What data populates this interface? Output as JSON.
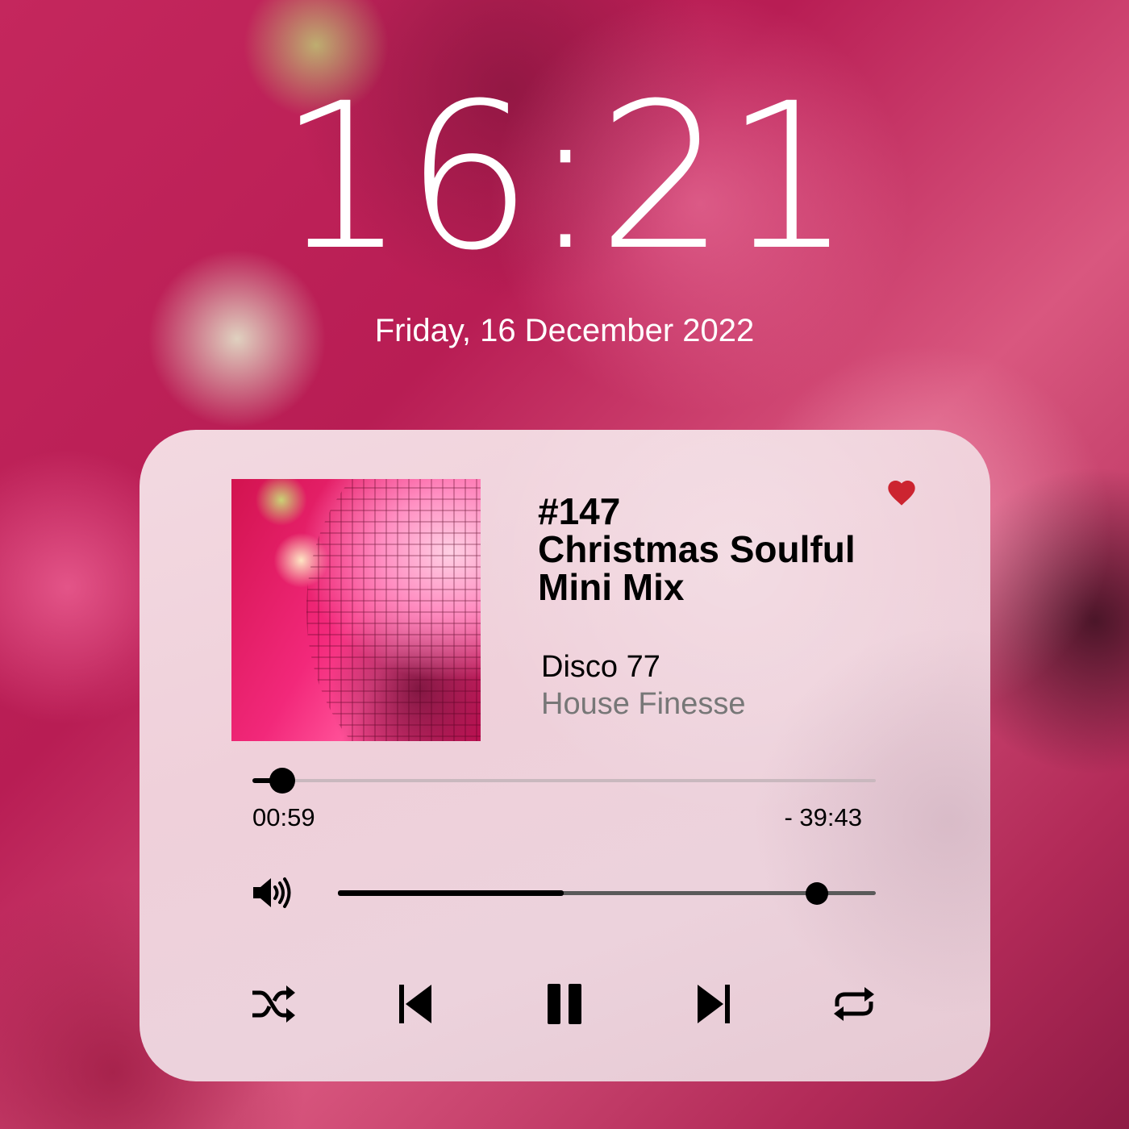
{
  "lockscreen": {
    "time": "16:21",
    "date": "Friday, 16 December 2022"
  },
  "player": {
    "track": {
      "title_line1": "#147",
      "title_line2": "Christmas Soulful",
      "title_line3": "Mini Mix",
      "artist": "Disco 77",
      "album": "House Finesse",
      "liked": true
    },
    "progress": {
      "elapsed": "00:59",
      "remaining": "- 39:43",
      "fraction": 0.048
    },
    "volume": {
      "level": 0.89,
      "buffered": 0.42
    },
    "controls": {
      "shuffle": "shuffle-icon",
      "previous": "skip-previous-icon",
      "play_state": "pause-icon",
      "next": "skip-next-icon",
      "repeat": "repeat-icon"
    },
    "colors": {
      "heart": "#cc2430",
      "accent": "#000000",
      "secondary_text": "#777777"
    }
  }
}
